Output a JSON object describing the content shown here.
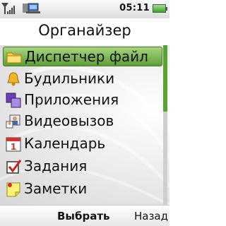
{
  "status_bar": {
    "time": "05:11",
    "icons": [
      "signal-strength-icon",
      "sim-icon",
      "laptop-connection-icon",
      "battery-icon"
    ]
  },
  "header": {
    "title": "Органайзер"
  },
  "menu": {
    "items": [
      {
        "label": "Диспетчер файл",
        "icon": "folder-icon",
        "selected": true
      },
      {
        "label": "Будильники",
        "icon": "bell-icon"
      },
      {
        "label": "Приложения",
        "icon": "apps-icon"
      },
      {
        "label": "Видеовызов",
        "icon": "video-call-icon"
      },
      {
        "label": "Календарь",
        "icon": "calendar-icon"
      },
      {
        "label": "Задания",
        "icon": "checkbox-icon"
      },
      {
        "label": "Заметки",
        "icon": "note-icon"
      }
    ]
  },
  "softkeys": {
    "select": "Выбрать",
    "back": "Назад"
  },
  "colors": {
    "selection": "#7cb956",
    "scroll_thumb": "#57a52f",
    "background": "#e5e5e5"
  },
  "scroll": {
    "visible_fraction": 0.42
  }
}
